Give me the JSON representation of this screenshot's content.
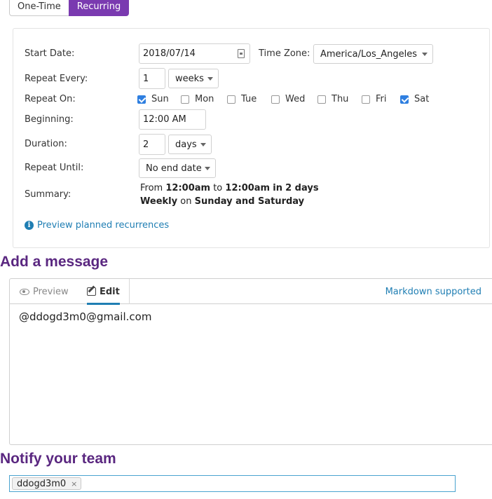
{
  "tabs": {
    "one_time": "One-Time",
    "recurring": "Recurring"
  },
  "form": {
    "start_date_label": "Start Date:",
    "start_date_value": "2018/07/14",
    "timezone_label": "Time Zone:",
    "timezone_value": "America/Los_Angeles",
    "repeat_every_label": "Repeat Every:",
    "repeat_every_value": "1",
    "repeat_every_unit": "weeks",
    "repeat_on_label": "Repeat On:",
    "days": [
      {
        "label": "Sun",
        "checked": true
      },
      {
        "label": "Mon",
        "checked": false
      },
      {
        "label": "Tue",
        "checked": false
      },
      {
        "label": "Wed",
        "checked": false
      },
      {
        "label": "Thu",
        "checked": false
      },
      {
        "label": "Fri",
        "checked": false
      },
      {
        "label": "Sat",
        "checked": true
      }
    ],
    "beginning_label": "Beginning:",
    "beginning_value": "12:00 AM",
    "duration_label": "Duration:",
    "duration_value": "2",
    "duration_unit": "days",
    "repeat_until_label": "Repeat Until:",
    "repeat_until_value": "No end date",
    "summary_label": "Summary:",
    "summary": {
      "from": "From",
      "start_time": "12:00am",
      "to": "to",
      "end_time": "12:00am",
      "in": "in",
      "duration": "2 days",
      "frequency": "Weekly",
      "on": "on",
      "days": "Sunday and Saturday"
    },
    "preview_link": "Preview planned recurrences"
  },
  "message": {
    "heading": "Add a message",
    "preview_tab": "Preview",
    "edit_tab": "Edit",
    "markdown_link": "Markdown supported",
    "body": "@ddogd3m0@gmail.com"
  },
  "notify": {
    "heading": "Notify your team",
    "tokens": [
      "ddogd3m0"
    ],
    "remove_glyph": "×"
  },
  "colors": {
    "accent": "#7a3ab0",
    "heading": "#5a2780",
    "link": "#1f7eb3",
    "checkbox": "#2f7fe0"
  }
}
